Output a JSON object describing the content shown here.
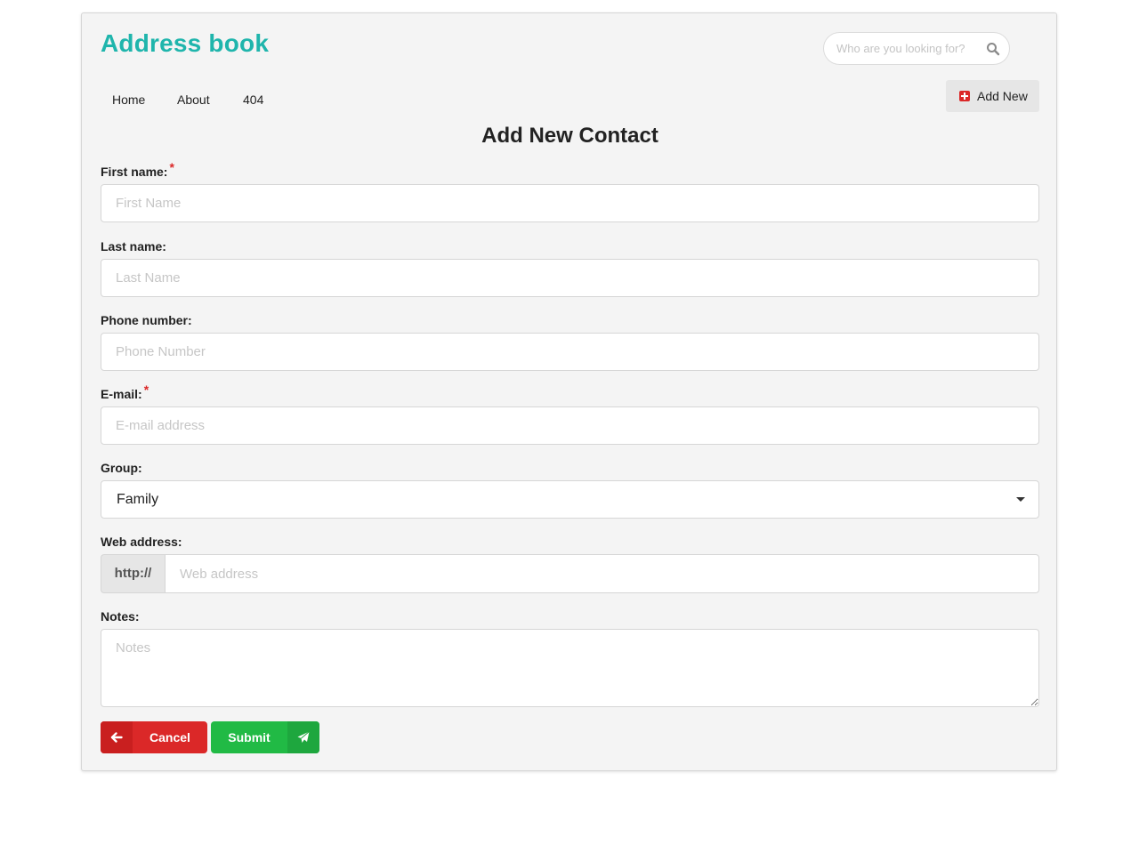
{
  "app": {
    "title": "Address book"
  },
  "search": {
    "placeholder": "Who are you looking for?",
    "icon": "search-icon"
  },
  "nav": {
    "items": [
      {
        "label": "Home"
      },
      {
        "label": "About"
      },
      {
        "label": "404"
      }
    ]
  },
  "header": {
    "add_new_label": "Add New",
    "add_new_icon": "plus-square-icon",
    "add_new_icon_color": "#db2828"
  },
  "page": {
    "title": "Add New Contact"
  },
  "form": {
    "first_name": {
      "label": "First name:",
      "required_mark": "*",
      "placeholder": "First Name",
      "value": ""
    },
    "last_name": {
      "label": "Last name:",
      "placeholder": "Last Name",
      "value": ""
    },
    "phone": {
      "label": "Phone number:",
      "placeholder": "Phone Number",
      "value": ""
    },
    "email": {
      "label": "E-mail:",
      "required_mark": "*",
      "placeholder": "E-mail address",
      "value": ""
    },
    "group": {
      "label": "Group:",
      "selected": "Family"
    },
    "web": {
      "label": "Web address:",
      "prefix": "http://",
      "placeholder": "Web address",
      "value": ""
    },
    "notes": {
      "label": "Notes:",
      "placeholder": "Notes",
      "value": ""
    }
  },
  "actions": {
    "cancel_label": "Cancel",
    "cancel_icon": "arrow-left-icon",
    "submit_label": "Submit",
    "submit_icon": "paper-plane-icon"
  },
  "colors": {
    "brand": "#1fb5ac",
    "danger": "#db2828",
    "success": "#21ba45",
    "required": "#db2828"
  }
}
